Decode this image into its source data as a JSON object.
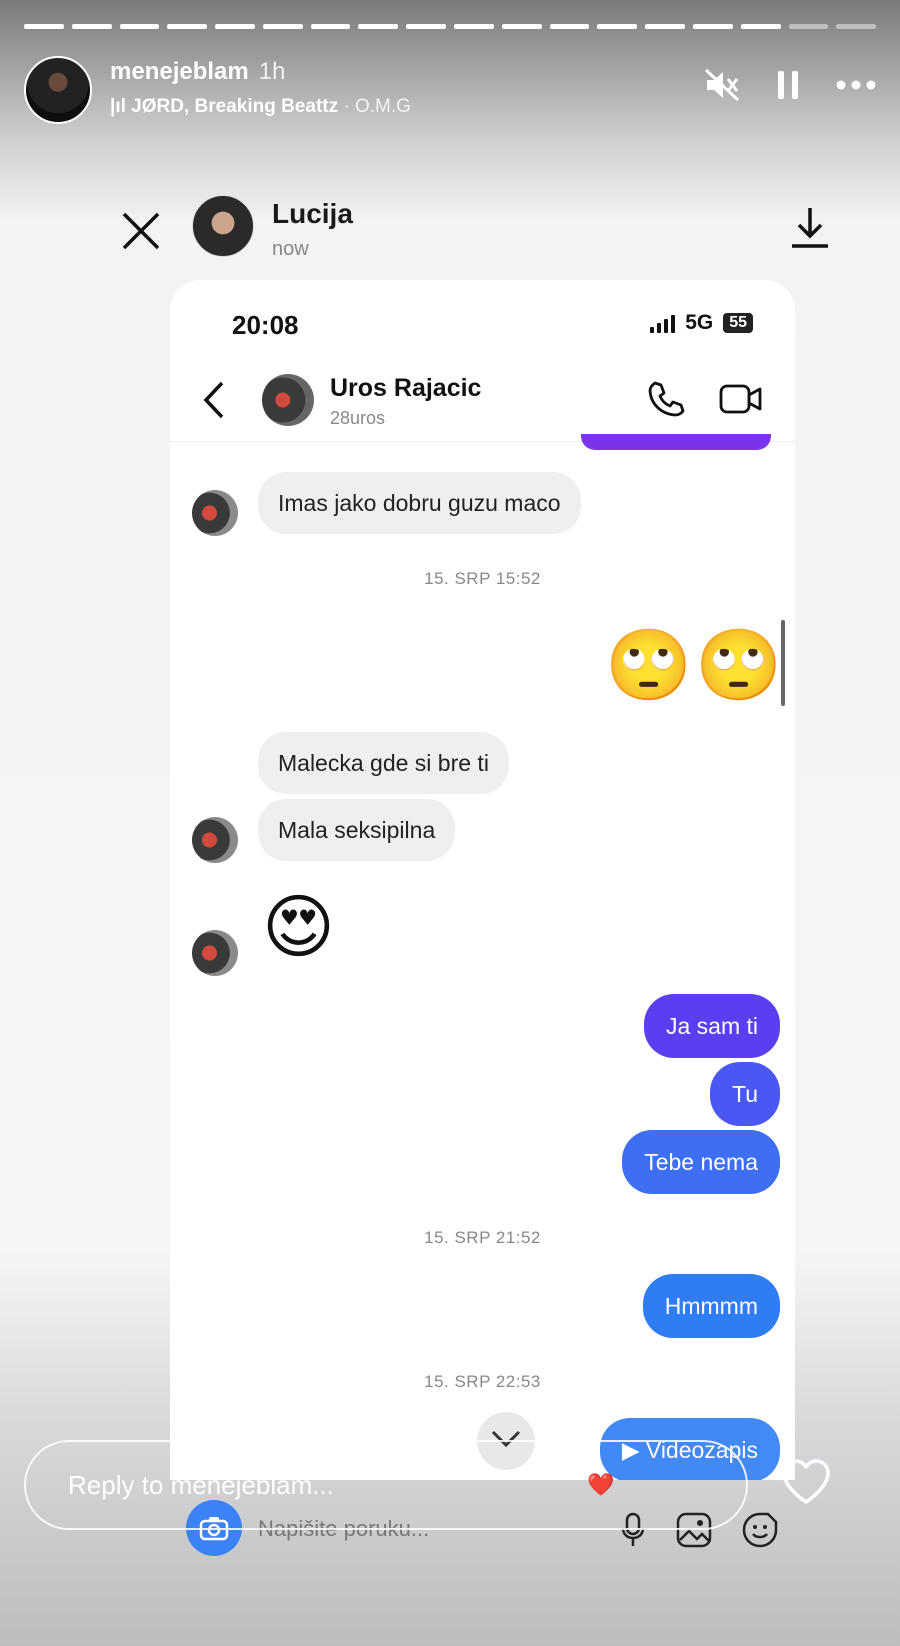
{
  "story": {
    "username": "menejeblam",
    "time": "1h",
    "music_artist": "JØRD, Breaking Beattz",
    "music_separator": "·",
    "music_track": "O.M.G",
    "progress": {
      "total": 18,
      "done": 16
    },
    "reply_placeholder": "Reply to menejeblam...",
    "icons": [
      "muted-speaker-icon",
      "pause-icon",
      "more-icon",
      "heart-icon"
    ]
  },
  "share": {
    "name": "Lucija",
    "status": "now",
    "icons": [
      "close-icon",
      "download-icon"
    ]
  },
  "phone": {
    "time": "20:08",
    "network": "5G",
    "battery": "55",
    "chat_name": "Uros Rajacic",
    "chat_handle": "28uros"
  },
  "messages": {
    "m1": "Imas jako dobru guzu maco",
    "ts1": "15. SRP 15:52",
    "emoji_rolling": "🙄",
    "m2": "Malecka gde si bre ti",
    "m3": "Mala seksipilna",
    "emoji_heart_eyes": "😍",
    "m4": "Ja sam ti",
    "m5": "Tu",
    "m6": "Tebe nema",
    "ts2": "15. SRP 21:52",
    "m7": "Hmmmm",
    "ts3": "15. SRP 22:53",
    "m8": "Videozapis"
  },
  "composer": {
    "placeholder": "Napišite poruku...",
    "reaction": "❤️"
  },
  "colors": {
    "outgoing_purple": "#5b3ef0",
    "outgoing_blue": "#2f7df5",
    "incoming": "#efeff2",
    "accent_purple": "#7a33e8"
  }
}
